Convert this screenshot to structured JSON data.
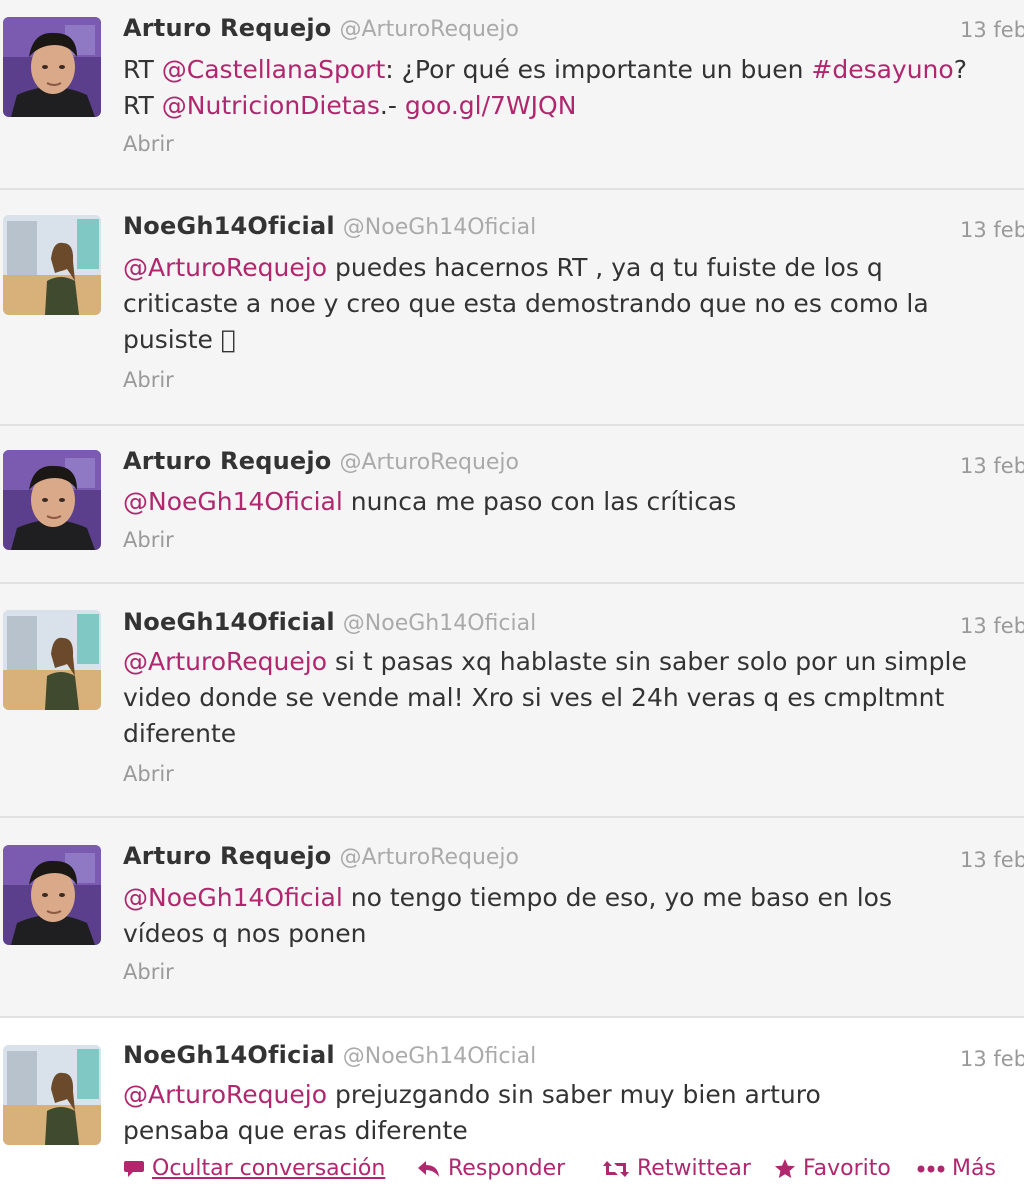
{
  "tweets": [
    {
      "name": "Arturo Requejo",
      "handle": "@ArturoRequejo",
      "time": "13 feb",
      "parts": [
        {
          "t": "RT "
        },
        {
          "t": "@CastellanaSport",
          "link": true
        },
        {
          "t": ": ¿Por qué es importante un buen "
        },
        {
          "t": "#desayuno",
          "link": true
        },
        {
          "t": "? RT "
        },
        {
          "t": "@NutricionDietas",
          "link": true
        },
        {
          "t": ".- "
        },
        {
          "t": "goo.gl/7WJQN",
          "link": true
        }
      ],
      "action": "Abrir"
    },
    {
      "name": "NoeGh14Oficial",
      "handle": "@NoeGh14Oficial",
      "time": "13 feb",
      "parts": [
        {
          "t": "@ArturoRequejo",
          "link": true
        },
        {
          "t": " puedes hacernos RT , ya q tu fuiste de los q criticaste a noe y creo que esta demostrando que no es como la pusiste "
        },
        {
          "t": "󾍝",
          "glyph": true
        }
      ],
      "action": "Abrir"
    },
    {
      "name": "Arturo Requejo",
      "handle": "@ArturoRequejo",
      "time": "13 feb",
      "parts": [
        {
          "t": "@NoeGh14Oficial",
          "link": true
        },
        {
          "t": " nunca me paso con las críticas"
        }
      ],
      "action": "Abrir"
    },
    {
      "name": "NoeGh14Oficial",
      "handle": "@NoeGh14Oficial",
      "time": "13 feb",
      "parts": [
        {
          "t": "@ArturoRequejo",
          "link": true
        },
        {
          "t": " si t pasas xq hablaste sin saber solo por un simple video donde se vende mal! Xro si ves el 24h veras q es cmpltmnt diferente"
        }
      ],
      "action": "Abrir"
    },
    {
      "name": "Arturo Requejo",
      "handle": "@ArturoRequejo",
      "time": "13 feb",
      "parts": [
        {
          "t": "@NoeGh14Oficial",
          "link": true
        },
        {
          "t": " no tengo tiempo de eso, yo me baso en los vídeos q nos ponen"
        }
      ],
      "action": "Abrir"
    },
    {
      "name": "NoeGh14Oficial",
      "handle": "@NoeGh14Oficial",
      "time": "13 feb",
      "parts": [
        {
          "t": "@ArturoRequejo",
          "link": true
        },
        {
          "t": " prejuzgando sin saber muy bien arturo pensaba que eras diferente"
        }
      ]
    }
  ],
  "actions": {
    "hide": "Ocultar conversación",
    "reply": "Responder",
    "retweet": "Retwittear",
    "favorite": "Favorito",
    "more": "Más"
  },
  "colors": {
    "link": "#b0276e",
    "background": "#f5f5f5",
    "divider": "#e1e1e1",
    "muted": "#999999"
  },
  "icons": [
    "speech-bubble-icon",
    "reply-arrow-icon",
    "retweet-icon",
    "star-icon",
    "more-dots-icon"
  ]
}
